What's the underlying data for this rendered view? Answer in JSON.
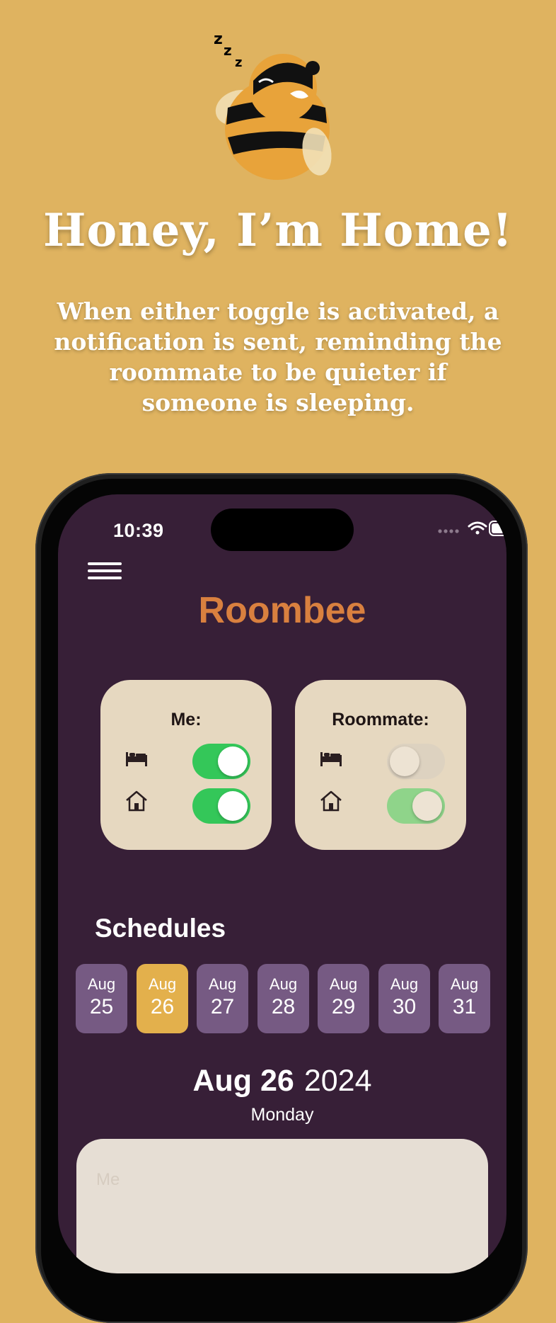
{
  "promo": {
    "headline": "Honey, I’m Home!",
    "description": "When either toggle is activated, a notification is sent, reminding the roommate to be quieter if someone is sleeping."
  },
  "status_bar": {
    "time": "10:39",
    "icons": [
      "signal-dots-icon",
      "wifi-icon",
      "battery-icon"
    ]
  },
  "app": {
    "title": "Roombee",
    "menu_icon": "hamburger-menu-icon"
  },
  "cards": {
    "me": {
      "title": "Me:",
      "sleep_toggle": {
        "icon": "bed-icon",
        "on": true
      },
      "home_toggle": {
        "icon": "home-icon",
        "on": true
      }
    },
    "roommate": {
      "title": "Roommate:",
      "sleep_toggle": {
        "icon": "bed-icon",
        "on": false
      },
      "home_toggle": {
        "icon": "home-icon",
        "on": true
      }
    }
  },
  "schedules": {
    "title": "Schedules",
    "dates": [
      {
        "month": "Aug",
        "day": "25",
        "selected": false
      },
      {
        "month": "Aug",
        "day": "26",
        "selected": true
      },
      {
        "month": "Aug",
        "day": "27",
        "selected": false
      },
      {
        "month": "Aug",
        "day": "28",
        "selected": false
      },
      {
        "month": "Aug",
        "day": "29",
        "selected": false
      },
      {
        "month": "Aug",
        "day": "30",
        "selected": false
      },
      {
        "month": "Aug",
        "day": "31",
        "selected": false
      }
    ],
    "selected": {
      "date": "Aug 26",
      "year": "2024",
      "weekday": "Monday"
    },
    "card_label": "Me"
  },
  "colors": {
    "background": "#DFB360",
    "screen": "#371F37",
    "accent": "#D9803F",
    "toggle_on": "#34C759",
    "date_chip": "#765A83",
    "date_selected": "#E3B04C",
    "card": "#E6D8C0"
  }
}
